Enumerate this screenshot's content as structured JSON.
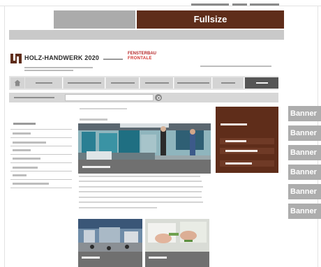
{
  "tabs": {
    "left_label": "",
    "fullsize_label": "Fullsize"
  },
  "header": {
    "logo_text": "HOLZ-HANDWERK 2020",
    "partner_logo_line1": "FENSTERBAU",
    "partner_logo_line2": "FRONTALE"
  },
  "banners": [
    "Banner",
    "Banner",
    "Banner",
    "Banner",
    "Banner",
    "Banner"
  ],
  "colors": {
    "brand": "#5f2d1a",
    "placeholder_gray": "#adadad",
    "nav_active": "#555555",
    "partner_red": "#d2322d"
  },
  "icons": {
    "home": "home-icon",
    "search": "search-icon"
  }
}
